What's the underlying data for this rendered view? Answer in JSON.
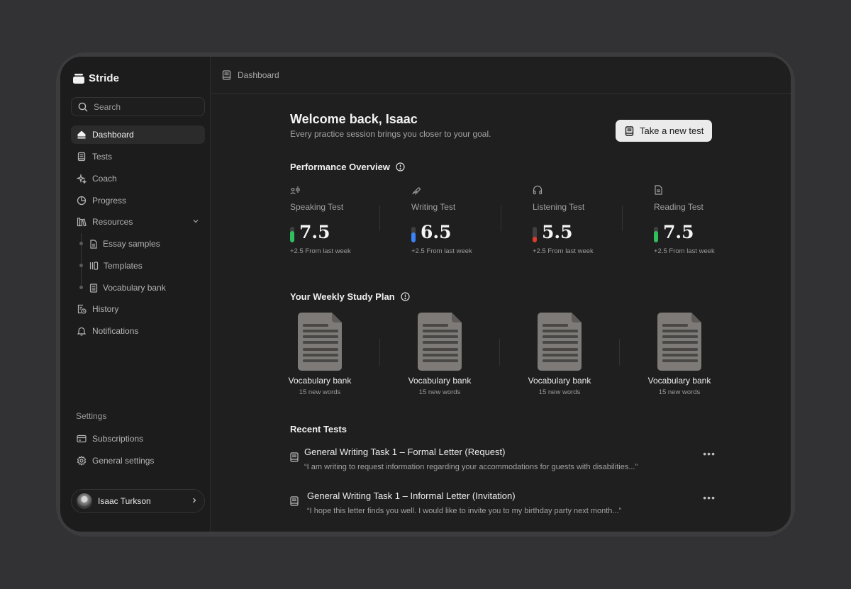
{
  "app": {
    "name": "Stride"
  },
  "search": {
    "placeholder": "Search"
  },
  "sidebar": {
    "items": [
      {
        "label": "Dashboard",
        "icon": "home-icon",
        "active": true
      },
      {
        "label": "Tests",
        "icon": "book-icon"
      },
      {
        "label": "Coach",
        "icon": "sparkle-icon"
      },
      {
        "label": "Progress",
        "icon": "pie-chart-icon"
      },
      {
        "label": "Resources",
        "icon": "library-icon",
        "expanded": true
      }
    ],
    "resources": [
      {
        "label": "Essay samples",
        "icon": "document-icon"
      },
      {
        "label": "Templates",
        "icon": "columns-icon"
      },
      {
        "label": "Vocabulary bank",
        "icon": "notebook-icon"
      }
    ],
    "bottom_items": [
      {
        "label": "History",
        "icon": "history-icon"
      },
      {
        "label": "Notifications",
        "icon": "bell-icon"
      }
    ],
    "settings_label": "Settings",
    "settings": [
      {
        "label": "Subscriptions",
        "icon": "credit-card-icon"
      },
      {
        "label": "General settings",
        "icon": "gear-icon"
      }
    ]
  },
  "user": {
    "name": "Isaac Turkson"
  },
  "breadcrumb": {
    "label": "Dashboard"
  },
  "welcome": {
    "title": "Welcome back, Isaac",
    "subtitle": "Every practice session brings you closer to your goal."
  },
  "cta": {
    "label": "Take a new test"
  },
  "performance": {
    "title": "Performance Overview",
    "metrics": [
      {
        "label": "Speaking Test",
        "score": "7.5",
        "delta": "+2.5 From last week",
        "icon": "microphone-waves-icon",
        "level": 0.75,
        "color": "#2fbf5c"
      },
      {
        "label": "Writing Test",
        "score": "6.5",
        "delta": "+2.5 From last week",
        "icon": "pen-icon",
        "level": 0.65,
        "color": "#3b82f6"
      },
      {
        "label": "Listening Test",
        "score": "5.5",
        "delta": "+2.5 From last week",
        "icon": "headphones-icon",
        "level": 0.35,
        "color": "#e0392b"
      },
      {
        "label": "Reading Test",
        "score": "7.5",
        "delta": "+2.5 From last week",
        "icon": "file-text-icon",
        "level": 0.75,
        "color": "#2fbf5c"
      }
    ]
  },
  "study_plan": {
    "title": "Your Weekly Study Plan",
    "items": [
      {
        "title": "Vocabulary bank",
        "subtitle": "15 new words"
      },
      {
        "title": "Vocabulary bank",
        "subtitle": "15 new words"
      },
      {
        "title": "Vocabulary bank",
        "subtitle": "15 new words"
      },
      {
        "title": "Vocabulary bank",
        "subtitle": "15 new words"
      }
    ]
  },
  "recent_tests": {
    "title": "Recent Tests",
    "items": [
      {
        "title": "General Writing Task 1 – Formal Letter (Request)",
        "snippet": "“I am writing to request information regarding your accommodations for guests with disabilities...”"
      },
      {
        "title": "General Writing Task 1 – Informal Letter (Invitation)",
        "snippet": "“I hope this letter finds you well. I would like to invite you to my birthday party next month...”"
      }
    ]
  }
}
